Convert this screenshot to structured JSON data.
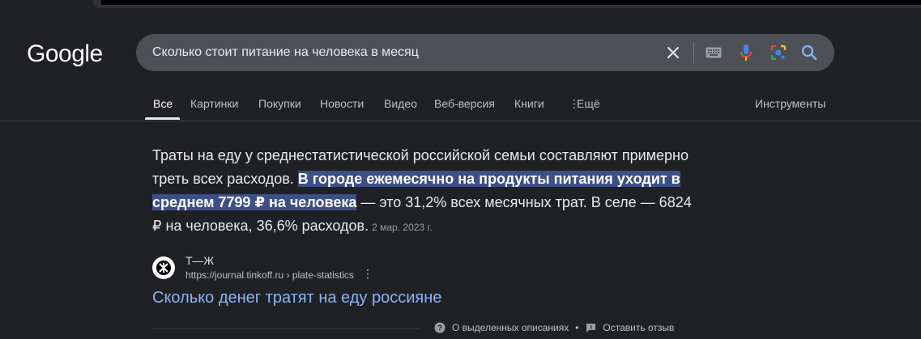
{
  "logo": "Google",
  "search": {
    "query": "Сколько стоит питание на человека в месяц"
  },
  "icons": {
    "clear": "close-icon",
    "keyboard": "keyboard-icon",
    "voice": "microphone-icon",
    "lens": "camera-lens-icon",
    "search": "search-icon"
  },
  "tabs": [
    {
      "label": "Все",
      "active": true
    },
    {
      "label": "Картинки"
    },
    {
      "label": "Покупки"
    },
    {
      "label": "Новости"
    },
    {
      "label": "Видео"
    },
    {
      "label": "Веб-версия"
    },
    {
      "label": "Книги"
    },
    {
      "label": "Ещё"
    }
  ],
  "tools_label": "Инструменты",
  "featured": {
    "part1": "Траты на еду у среднестатистической российской семьи составляют примерно треть всех расходов. ",
    "highlight": "В городе ежемесячно на продукты питания уходит в среднем 7799 ₽ на человека",
    "part2": " — это 31,2% всех месячных трат. В селе — 6824 ₽ на человека, 36,6% расходов.",
    "date": "2 мар. 2023 г."
  },
  "source": {
    "name": "Т—Ж",
    "url": "https://journal.tinkoff.ru › plate-statistics",
    "title": "Сколько денег тратят на еду россияне"
  },
  "footer": {
    "about": "О выделенных описаниях",
    "separator": "•",
    "feedback": "Оставить отзыв"
  },
  "colors": {
    "background": "#202124",
    "searchbox": "#4d5156",
    "link": "#8ab4f8",
    "highlight": "#3c4f88"
  }
}
